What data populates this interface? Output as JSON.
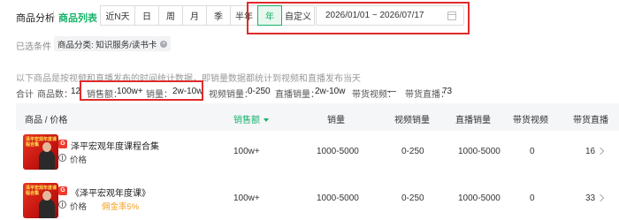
{
  "header": {
    "tab_analysis": "商品分析",
    "tab_list": "商品列表",
    "periods": [
      {
        "label": "近N天",
        "active": false
      },
      {
        "label": "日",
        "active": false
      },
      {
        "label": "周",
        "active": false
      },
      {
        "label": "月",
        "active": false
      },
      {
        "label": "季",
        "active": false
      },
      {
        "label": "半年",
        "active": false
      },
      {
        "label": "年",
        "active": true
      },
      {
        "label": "自定义",
        "active": false
      }
    ],
    "date_range": "2026/01/01 ~ 2026/07/17"
  },
  "filters": {
    "label": "已选条件",
    "chip": "商品分类: 知识服务/读书卡",
    "chip_close": "×"
  },
  "note": "以下商品是按视频和直播发布的时间统计数据，即销量数据都统计到视频和直播发布当天",
  "totals": {
    "label": "合计",
    "count_label": "商品数：",
    "count_value": "12",
    "sales_amount_label": "销售额：",
    "sales_amount_value": "100w+",
    "sales_volume_label": "销量：",
    "sales_volume_value": "2w-10w",
    "video_sales_label": "视频销量：",
    "video_sales_value": "0-250",
    "live_sales_label": "直播销量：",
    "live_sales_value": "2w-10w",
    "video_promo_label": "带货视频：",
    "video_promo_value": "—",
    "live_promo_label": "带货直播：",
    "live_promo_value": "73"
  },
  "table": {
    "columns": [
      "商品 / 价格",
      "销售额",
      "销量",
      "视频销量",
      "直播销量",
      "带货视频",
      "带货直播"
    ],
    "rows": [
      {
        "thumb_text": "泽平宏观年度课程合集",
        "badge": "G",
        "title": "泽平宏观年度课程合集",
        "price_label": "价格",
        "commission": "",
        "sales_amount": "100w+",
        "sales_volume": "1000-5000",
        "video_sales": "0-250",
        "live_sales": "1000-5000",
        "video_promo": "0",
        "live_promo": "16"
      },
      {
        "thumb_text": "泽平宏观年度课程合集",
        "badge": "G",
        "title": "《泽平宏观年度课》",
        "price_label": "价格",
        "commission": "佣金率5%",
        "sales_amount": "100w+",
        "sales_volume": "1000-5000",
        "video_sales": "0-250",
        "live_sales": "1000-5000",
        "video_promo": "0",
        "live_promo": "33"
      }
    ]
  }
}
